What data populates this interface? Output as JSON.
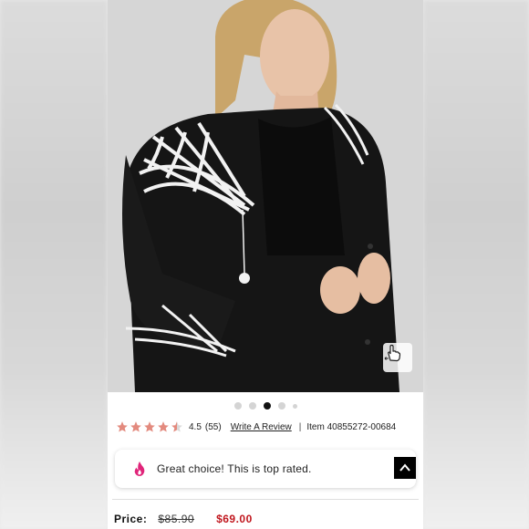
{
  "gallery": {
    "dots": [
      false,
      false,
      true,
      false,
      false
    ],
    "zoom_icon": "hand-pointer-icon"
  },
  "rating": {
    "stars": 4.5,
    "score": "4.5",
    "count": "(55)",
    "review_link": "Write A Review",
    "separator": "|",
    "item_number": "Item 40855272-00684",
    "star_color": "#e38a7e"
  },
  "banner": {
    "message": "Great choice! This is top rated.",
    "icon": "flame-icon",
    "icon_color": "#e0257a",
    "back_to_top_icon": "chevron-up-icon"
  },
  "price": {
    "label": "Price:",
    "was": "$85.90",
    "now": "$69.00",
    "now_color": "#c0161d"
  }
}
